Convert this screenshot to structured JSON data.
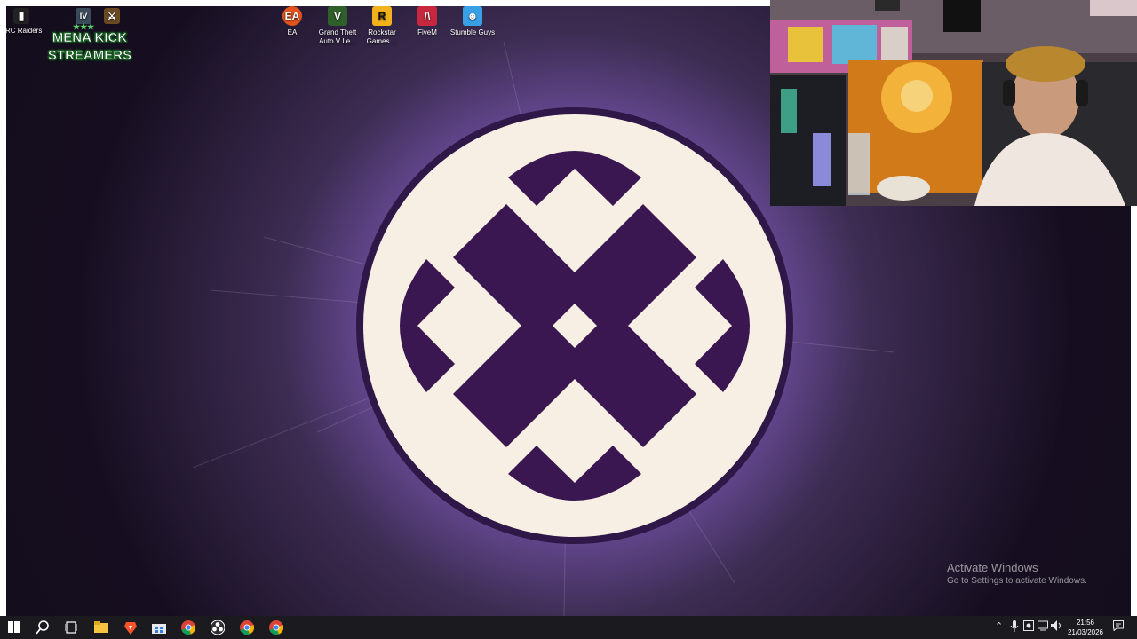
{
  "desktop": {
    "icons": [
      {
        "label": "ARC Raiders",
        "icon": "arc-raiders-icon",
        "color": "#222222"
      },
      {
        "label": "EA",
        "icon": "ea-icon",
        "color": "#e4531d"
      },
      {
        "label": "Grand Theft Auto V Le...",
        "icon": "gta-v-icon",
        "color": "#2f5f2a"
      },
      {
        "label": "Rockstar Games ...",
        "icon": "rockstar-icon",
        "color": "#f2b21b"
      },
      {
        "label": "FiveM",
        "icon": "fivem-icon",
        "color": "#c8283f"
      },
      {
        "label": "Stumble Guys",
        "icon": "stumble-guys-icon",
        "color": "#3aa0e6"
      }
    ],
    "badge": {
      "line1": "MENA KICK",
      "line2": "STREAMERS",
      "stars": "★★★"
    },
    "wallpaper": {
      "background": "#1a1024",
      "glow": "#7e4ecc",
      "disc": "#f7efe3",
      "mark": "#3a1750"
    }
  },
  "watermark": {
    "title": "Activate Windows",
    "subtitle": "Go to Settings to activate Windows."
  },
  "taskbar": {
    "apps": [
      "start-icon",
      "search-icon",
      "task-view-icon",
      "file-explorer-icon",
      "brave-icon",
      "store-icon",
      "chrome-icon",
      "obs-icon",
      "chrome-icon",
      "chrome-icon"
    ],
    "tray": [
      "chevron-up-icon",
      "microphone-icon",
      "app-tray-icon",
      "wifi-icon",
      "volume-icon"
    ],
    "time": "21:56",
    "date": "21/03/2026",
    "notification_icon": "notification-icon"
  }
}
